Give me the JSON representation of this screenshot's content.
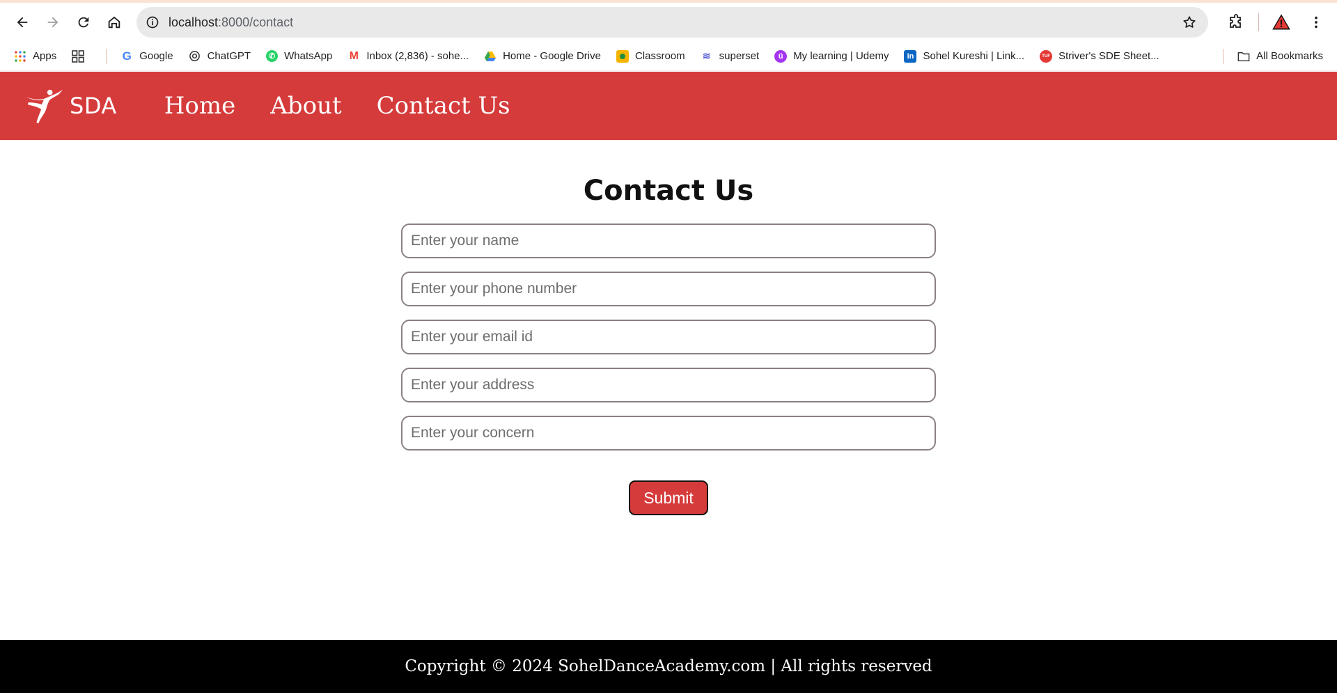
{
  "browser": {
    "url_host": "localhost",
    "url_path": ":8000/contact",
    "bookmarks": [
      {
        "label": "Apps",
        "icon": "apps-grid-icon"
      },
      {
        "label": "",
        "icon": "tab-groups-icon"
      },
      {
        "label": "Google",
        "icon": "google-icon"
      },
      {
        "label": "ChatGPT",
        "icon": "chatgpt-icon"
      },
      {
        "label": "WhatsApp",
        "icon": "whatsapp-icon"
      },
      {
        "label": "Inbox (2,836) - sohe...",
        "icon": "gmail-icon"
      },
      {
        "label": "Home - Google Drive",
        "icon": "google-drive-icon"
      },
      {
        "label": "Classroom",
        "icon": "classroom-icon"
      },
      {
        "label": "superset",
        "icon": "superset-icon"
      },
      {
        "label": "My learning | Udemy",
        "icon": "udemy-icon"
      },
      {
        "label": "Sohel Kureshi | Link...",
        "icon": "linkedin-icon"
      },
      {
        "label": "Striver's SDE Sheet...",
        "icon": "tuf-icon"
      }
    ],
    "all_bookmarks": "All Bookmarks"
  },
  "site": {
    "brand": "SDA",
    "nav": [
      "Home",
      "About",
      "Contact Us"
    ],
    "accent_color": "#d63b3b"
  },
  "contact": {
    "title": "Contact Us",
    "fields": [
      "Enter your name",
      "Enter your phone number",
      "Enter your email id",
      "Enter your address",
      "Enter your concern"
    ],
    "submit_label": "Submit"
  },
  "footer": {
    "text": "Copyright © 2024 SohelDanceAcademy.com | All rights reserved"
  }
}
